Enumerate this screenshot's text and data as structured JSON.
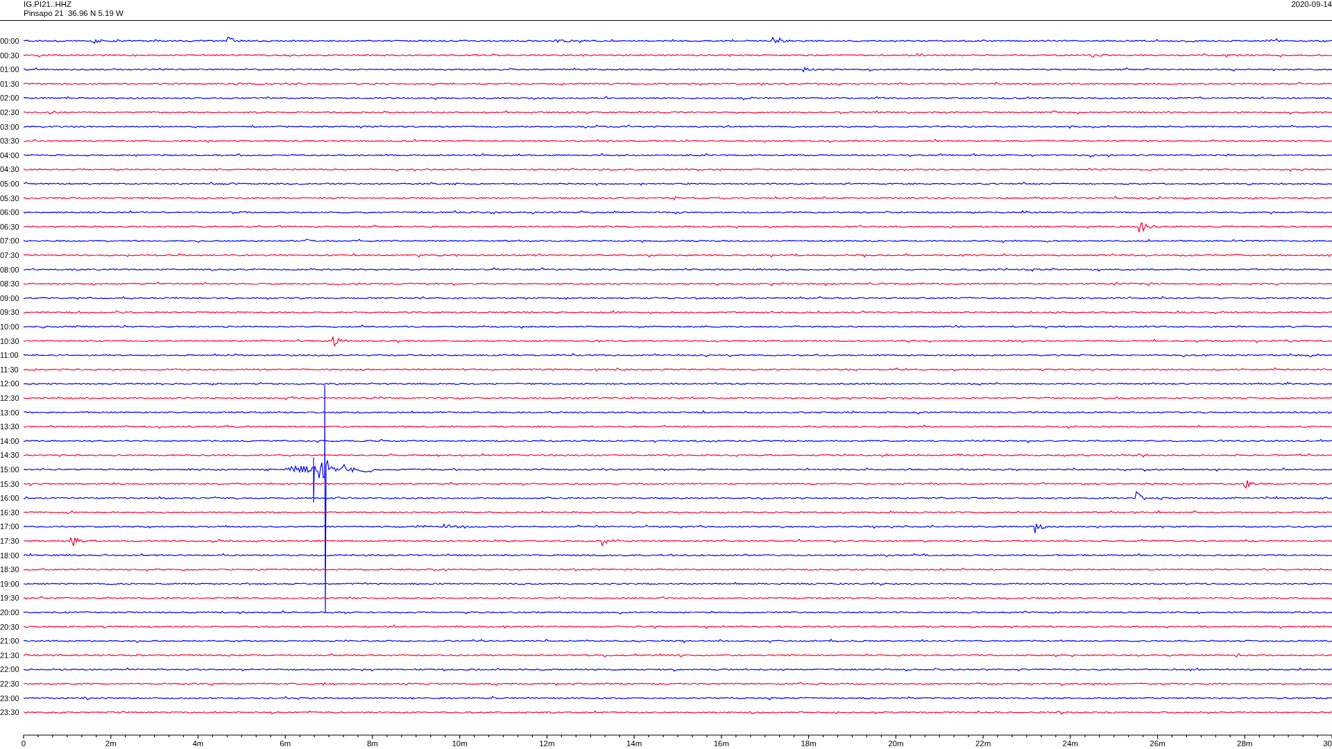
{
  "header": {
    "station": "IG.PI21..HHZ",
    "location": "Pinsapo 21  36.96 N 5.19 W",
    "date": "2020-09-14"
  },
  "traces": [
    {
      "time": "00:00",
      "color": "#0000ff"
    },
    {
      "time": "00:30",
      "color": "#ff0033"
    },
    {
      "time": "01:00",
      "color": "#0000ff"
    },
    {
      "time": "01:30",
      "color": "#ff0033"
    },
    {
      "time": "02:00",
      "color": "#0000ff"
    },
    {
      "time": "02:30",
      "color": "#ff0033"
    },
    {
      "time": "03:00",
      "color": "#0000ff"
    },
    {
      "time": "03:30",
      "color": "#ff0033"
    },
    {
      "time": "04:00",
      "color": "#0000ff"
    },
    {
      "time": "04:30",
      "color": "#ff0033"
    },
    {
      "time": "05:00",
      "color": "#0000ff"
    },
    {
      "time": "05:30",
      "color": "#ff0033"
    },
    {
      "time": "06:00",
      "color": "#0000ff"
    },
    {
      "time": "06:30",
      "color": "#ff0033"
    },
    {
      "time": "07:00",
      "color": "#0000ff"
    },
    {
      "time": "07:30",
      "color": "#ff0033"
    },
    {
      "time": "08:00",
      "color": "#0000ff"
    },
    {
      "time": "08:30",
      "color": "#ff0033"
    },
    {
      "time": "09:00",
      "color": "#0000ff"
    },
    {
      "time": "09:30",
      "color": "#ff0033"
    },
    {
      "time": "10:00",
      "color": "#0000ff"
    },
    {
      "time": "10:30",
      "color": "#ff0033"
    },
    {
      "time": "11:00",
      "color": "#0000ff"
    },
    {
      "time": "11:30",
      "color": "#ff0033"
    },
    {
      "time": "12:00",
      "color": "#0000ff"
    },
    {
      "time": "12:30",
      "color": "#ff0033"
    },
    {
      "time": "13:00",
      "color": "#0000ff"
    },
    {
      "time": "13:30",
      "color": "#ff0033"
    },
    {
      "time": "14:00",
      "color": "#0000ff"
    },
    {
      "time": "14:30",
      "color": "#ff0033"
    },
    {
      "time": "15:00",
      "color": "#0000ff"
    },
    {
      "time": "15:30",
      "color": "#ff0033"
    },
    {
      "time": "16:00",
      "color": "#0000ff"
    },
    {
      "time": "16:30",
      "color": "#ff0033"
    },
    {
      "time": "17:00",
      "color": "#0000ff"
    },
    {
      "time": "17:30",
      "color": "#ff0033"
    },
    {
      "time": "18:00",
      "color": "#0000ff"
    },
    {
      "time": "18:30",
      "color": "#ff0033"
    },
    {
      "time": "19:00",
      "color": "#0000ff"
    },
    {
      "time": "19:30",
      "color": "#ff0033"
    },
    {
      "time": "20:00",
      "color": "#0000ff"
    },
    {
      "time": "20:30",
      "color": "#ff0033"
    },
    {
      "time": "21:00",
      "color": "#0000ff"
    },
    {
      "time": "21:30",
      "color": "#ff0033"
    },
    {
      "time": "22:00",
      "color": "#0000ff"
    },
    {
      "time": "22:30",
      "color": "#ff0033"
    },
    {
      "time": "23:00",
      "color": "#0000ff"
    },
    {
      "time": "23:30",
      "color": "#ff0033"
    }
  ],
  "x_axis": {
    "labels": [
      "0",
      "2m",
      "4m",
      "6m",
      "8m",
      "10m",
      "12m",
      "14m",
      "16m",
      "18m",
      "20m",
      "22m",
      "24m",
      "26m",
      "28m",
      "30"
    ]
  }
}
